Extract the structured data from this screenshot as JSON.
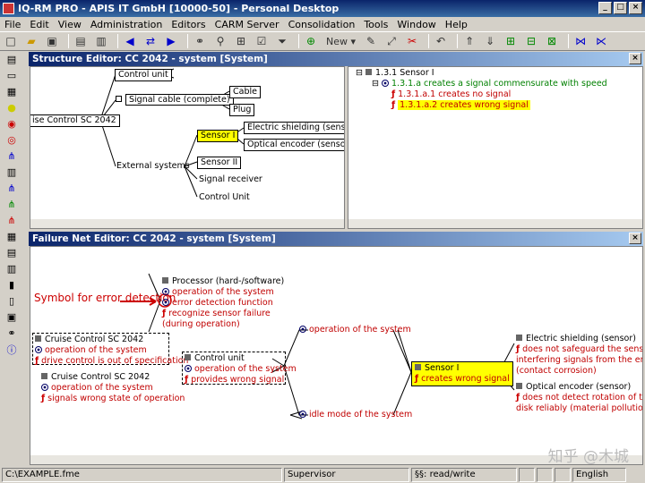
{
  "window": {
    "title": "IQ-RM PRO - APIS IT GmbH [10000-50] - Personal Desktop"
  },
  "menu": [
    "File",
    "Edit",
    "View",
    "Administration",
    "Editors",
    "CARM Server",
    "Consolidation",
    "Tools",
    "Window",
    "Help"
  ],
  "toolbar": {
    "new_label": "New"
  },
  "structure_editor": {
    "title": "Structure Editor: CC 2042 - system [System]",
    "root": "ise Control SC 2042",
    "control_unit": "Control unit",
    "signal_cable": "Signal cable (complete)",
    "cable": "Cable",
    "plug": "Plug",
    "external_systems": "External systems",
    "sensor_1": "Sensor I",
    "electric_shielding": "Electric shielding (sensor)",
    "optical_encoder": "Optical encoder (sensor)",
    "sensor_2": "Sensor II",
    "signal_receiver": "Signal receiver",
    "control_unit_2": "Control Unit"
  },
  "function_tree": {
    "root": "1.3.1 Sensor I",
    "func": "1.3.1.a creates a signal commensurate with speed",
    "fail1": "1.3.1.a.1 creates no signal",
    "fail2": "1.3.1.a.2 creates wrong signal"
  },
  "failure_net": {
    "title": "Failure Net Editor: CC 2042 - system [System]",
    "annotation": "Symbol for error detection",
    "processor": {
      "name": "Processor (hard-/software)",
      "func": "operation of the system",
      "detect": "error detection function",
      "fail": "recognize sensor failure (during operation)"
    },
    "cc1": {
      "name": "Cruise Control SC 2042",
      "func": "operation of the system",
      "fail": "drive control is out of specification"
    },
    "control_unit": {
      "name": "Control unit",
      "func": "operation of the system",
      "fail": "provides wrong signal"
    },
    "cc2": {
      "name": "Cruise Control SC 2042",
      "func": "operation of the system",
      "fail": "signals wrong state of operation"
    },
    "op_mid": "operation of the system",
    "idle_mid": "idle mode of the system",
    "sensor": {
      "name": "Sensor I",
      "fail": "creates wrong signal"
    },
    "shielding": {
      "name": "Electric shielding (sensor)",
      "fail": "does not safeguard the senso",
      "fail2": "interfering signals from the envir",
      "fail3": "(contact corrosion)"
    },
    "optical": {
      "name": "Optical encoder (sensor)",
      "fail": "does not detect rotation of th",
      "fail2": "disk reliably (material pollution)"
    }
  },
  "status": {
    "path": "C:\\EXAMPLE.fme",
    "user": "Supervisor",
    "mode": "read/write",
    "lang": "English"
  },
  "watermark": "知乎 @木城"
}
